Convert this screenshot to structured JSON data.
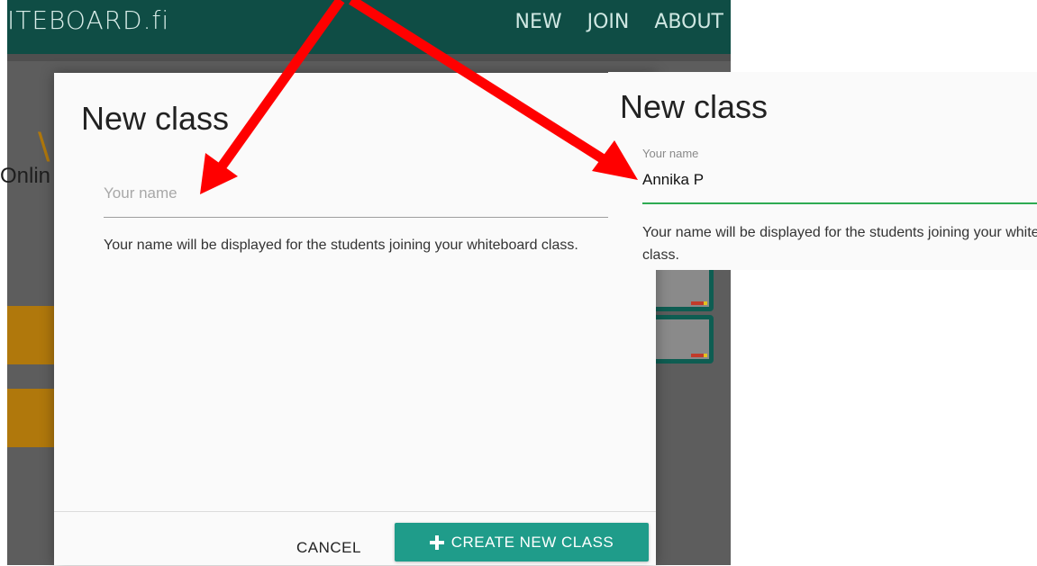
{
  "app": {
    "logo": "ITEBOARD.fi",
    "nav": [
      "NEW",
      "JOIN",
      "ABOUT"
    ],
    "body_text": "Onlin"
  },
  "dialog": {
    "title": "New class",
    "name_placeholder": "Your name",
    "help_text": "Your name will be displayed for the students joining your whiteboard class.",
    "cancel_label": "CANCEL",
    "create_label": "CREATE NEW CLASS"
  },
  "inset": {
    "title": "New class",
    "field_label": "Your name",
    "field_value": "Annika P",
    "help_text": "Your name will be displayed for the students joining your whiteboard class."
  },
  "colors": {
    "app_bar": "#0f4d45",
    "primary_button": "#1f9c8a",
    "input_focus_underline": "#2eab53",
    "arrow": "#ff0000"
  }
}
